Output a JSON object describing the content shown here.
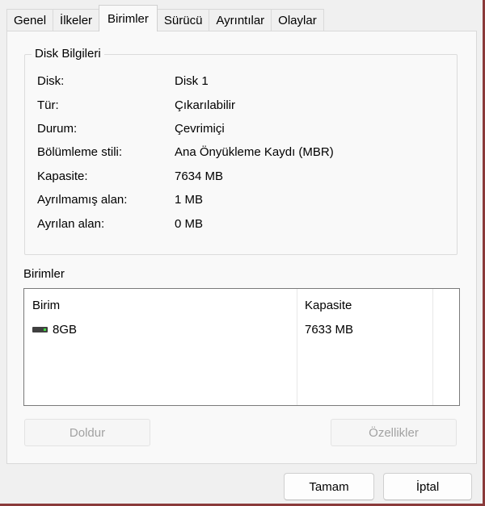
{
  "tabs": [
    {
      "label": "Genel"
    },
    {
      "label": "İlkeler"
    },
    {
      "label": "Birimler",
      "active": true
    },
    {
      "label": "Sürücü"
    },
    {
      "label": "Ayrıntılar"
    },
    {
      "label": "Olaylar"
    }
  ],
  "disk_info": {
    "legend": "Disk Bilgileri",
    "rows": [
      {
        "label": "Disk:",
        "value": "Disk 1"
      },
      {
        "label": "Tür:",
        "value": "Çıkarılabilir"
      },
      {
        "label": "Durum:",
        "value": "Çevrimiçi"
      },
      {
        "label": "Bölümleme stili:",
        "value": "Ana Önyükleme Kaydı (MBR)"
      },
      {
        "label": "Kapasite:",
        "value": "7634 MB"
      },
      {
        "label": "Ayrılmamış alan:",
        "value": "1 MB"
      },
      {
        "label": "Ayrılan alan:",
        "value": "0 MB"
      }
    ]
  },
  "volumes": {
    "section_label": "Birimler",
    "columns": [
      "Birim",
      "Kapasite"
    ],
    "rows": [
      {
        "name": "8GB",
        "capacity": "7633 MB",
        "icon": "usb-drive-icon"
      }
    ]
  },
  "buttons": {
    "populate": "Doldur",
    "properties": "Özellikler",
    "ok": "Tamam",
    "cancel": "İptal"
  }
}
